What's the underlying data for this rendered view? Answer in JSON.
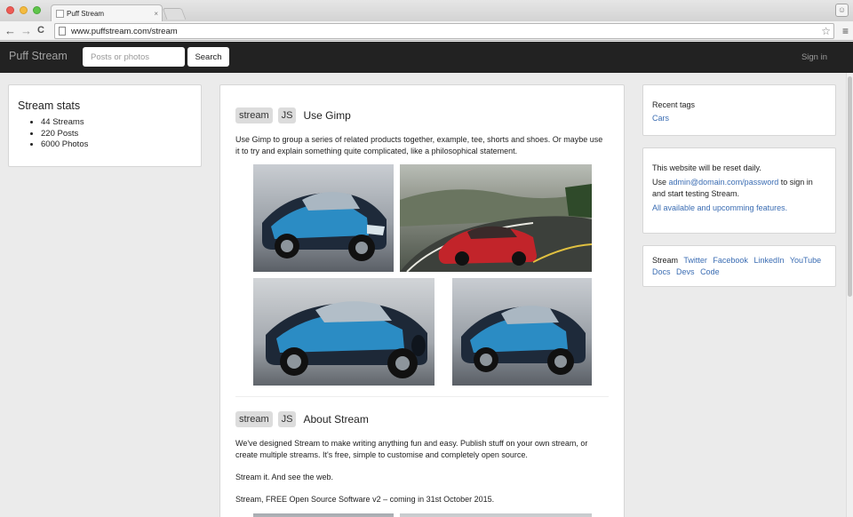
{
  "browser": {
    "tab_title": "Puff Stream",
    "tab_close": "×",
    "back_glyph": "←",
    "forward_glyph": "→",
    "reload_glyph": "C",
    "url": "www.puffstream.com/stream",
    "star_glyph": "☆",
    "menu_glyph": "≡"
  },
  "header": {
    "brand": "Puff Stream",
    "search_placeholder": "Posts or photos",
    "search_button": "Search",
    "sign_in": "Sign in"
  },
  "stats": {
    "title": "Stream stats",
    "items": [
      "44 Streams",
      "220 Posts",
      "6000 Photos"
    ]
  },
  "posts": [
    {
      "tags": [
        "stream",
        "JS"
      ],
      "title": "Use Gimp",
      "paragraphs": [
        "Use Gimp to group a series of related products together, example, tee, shorts and shoes. Or maybe use it to try and explain something quite complicated, like a philosophical statement."
      ]
    },
    {
      "tags": [
        "stream",
        "JS"
      ],
      "title": "About Stream",
      "paragraphs": [
        "We've designed Stream to make writing anything fun and easy. Publish stuff on your own stream, or create multiple streams. It's free, simple to customise and completely open source.",
        "Stream it. And see the web.",
        "Stream, FREE Open Source Software v2 – coming in 31st October 2015."
      ]
    }
  ],
  "sidebar": {
    "recent_tags_title": "Recent tags",
    "recent_tags": [
      "Cars"
    ],
    "notice_title": "This website will be reset daily.",
    "notice_prefix": "Use ",
    "notice_email": "admin@domain.com/password",
    "notice_suffix": " to sign in and start testing Stream.",
    "features_link": "All available and upcomming features.",
    "footer_label": "Stream",
    "footer_links": [
      "Twitter",
      "Facebook",
      "LinkedIn",
      "YouTube",
      "Docs",
      "Devs",
      "Code"
    ]
  },
  "colors": {
    "header_bg": "#222222",
    "link": "#3b6db3",
    "tag_bg": "#dcdcdc",
    "page_bg": "#ebebeb"
  }
}
